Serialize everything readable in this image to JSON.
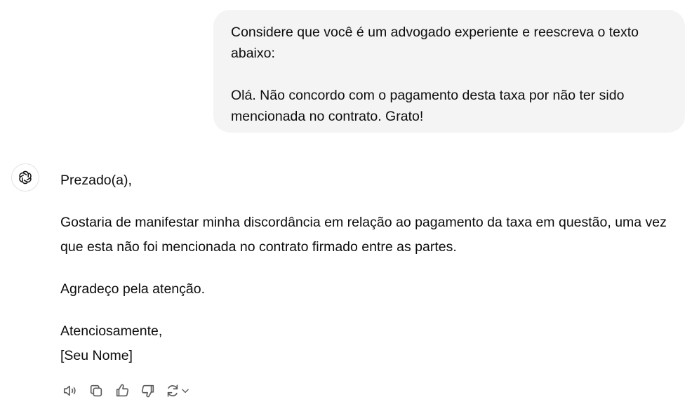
{
  "user_message": {
    "paragraphs": [
      "Considere que você é um advogado experiente e reescreva o texto abaixo:",
      "Olá. Não concordo com o pagamento desta taxa por não ter sido mencionada no contrato. Grato!"
    ]
  },
  "assistant": {
    "avatar_icon": "openai-logo-icon",
    "greeting": "Prezado(a),",
    "body": "Gostaria de manifestar minha discordância em relação ao pagamento da taxa em questão, uma vez que esta não foi mencionada no contrato firmado entre as partes.",
    "thanks": "Agradeço pela atenção.",
    "closing": "Atenciosamente,",
    "signature": "[Seu Nome]"
  },
  "actions": {
    "icons": [
      "read-aloud-icon",
      "copy-icon",
      "thumbs-up-icon",
      "thumbs-down-icon",
      "regenerate-icon",
      "chevron-down-icon"
    ]
  },
  "colors": {
    "bubble_background": "#f4f4f4",
    "text": "#0d0d0d",
    "icon": "#5d5d5d"
  }
}
